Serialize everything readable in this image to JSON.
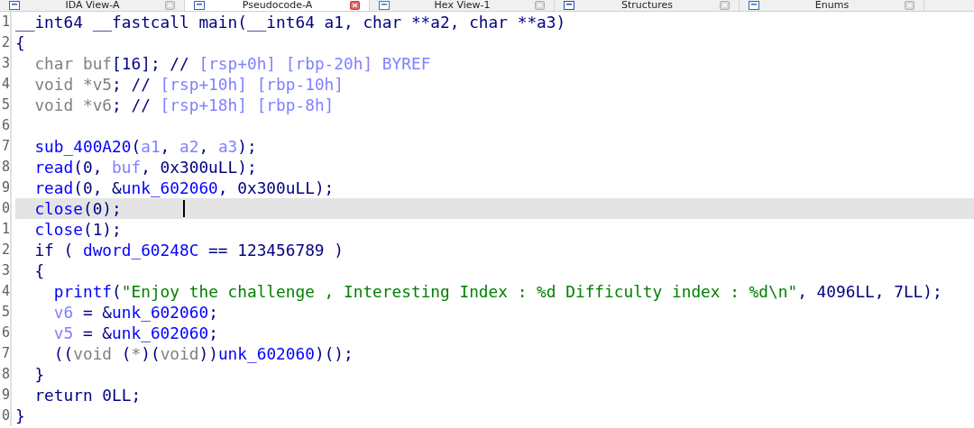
{
  "tabs": [
    {
      "label": "IDA View-A",
      "selected": false
    },
    {
      "label": "Pseudocode-A",
      "selected": true
    },
    {
      "label": "Hex View-1",
      "selected": false
    },
    {
      "label": "Structures",
      "selected": false
    },
    {
      "label": "Enums",
      "selected": false
    }
  ],
  "lines": [
    {
      "number": "1",
      "current": false,
      "tokens": [
        {
          "kind": "plain",
          "text": "__int64 __fastcall main(__int64 a1, char **a2, char **a3)"
        }
      ]
    },
    {
      "number": "2",
      "current": false,
      "tokens": [
        {
          "kind": "plain",
          "text": "{"
        }
      ]
    },
    {
      "number": "3",
      "current": false,
      "tokens": [
        {
          "kind": "type",
          "text": "  char buf"
        },
        {
          "kind": "plain",
          "text": "[16]; // "
        },
        {
          "kind": "comment",
          "text": "[rsp+0h] [rbp-20h] BYREF"
        }
      ]
    },
    {
      "number": "4",
      "current": false,
      "tokens": [
        {
          "kind": "type",
          "text": "  void *v5"
        },
        {
          "kind": "plain",
          "text": "; // "
        },
        {
          "kind": "comment",
          "text": "[rsp+10h] [rbp-10h]"
        }
      ]
    },
    {
      "number": "5",
      "current": false,
      "tokens": [
        {
          "kind": "type",
          "text": "  void *v6"
        },
        {
          "kind": "plain",
          "text": "; // "
        },
        {
          "kind": "comment",
          "text": "[rsp+18h] [rbp-8h]"
        }
      ]
    },
    {
      "number": "6",
      "current": false
    },
    {
      "number": "7",
      "current": false,
      "tokens": [
        {
          "kind": "name",
          "text": "  sub_400A20"
        },
        {
          "kind": "plain",
          "text": "("
        },
        {
          "kind": "local",
          "text": "a1"
        },
        {
          "kind": "plain",
          "text": ", "
        },
        {
          "kind": "local",
          "text": "a2"
        },
        {
          "kind": "plain",
          "text": ", "
        },
        {
          "kind": "local",
          "text": "a3"
        },
        {
          "kind": "plain",
          "text": ");"
        }
      ]
    },
    {
      "number": "8",
      "current": false,
      "tokens": [
        {
          "kind": "name",
          "text": "  read"
        },
        {
          "kind": "plain",
          "text": "(0, "
        },
        {
          "kind": "local",
          "text": "buf"
        },
        {
          "kind": "plain",
          "text": ", 0x300uLL);"
        }
      ]
    },
    {
      "number": "9",
      "current": false,
      "tokens": [
        {
          "kind": "name",
          "text": "  read"
        },
        {
          "kind": "plain",
          "text": "(0, &"
        },
        {
          "kind": "name",
          "text": "unk_602060"
        },
        {
          "kind": "plain",
          "text": ", 0x300uLL);"
        }
      ]
    },
    {
      "number": "0",
      "current": true,
      "tokens": [
        {
          "kind": "name",
          "text": "  close"
        },
        {
          "kind": "plain",
          "text": "(0);"
        }
      ]
    },
    {
      "number": "1",
      "current": false,
      "tokens": [
        {
          "kind": "name",
          "text": "  close"
        },
        {
          "kind": "plain",
          "text": "(1);"
        }
      ]
    },
    {
      "number": "2",
      "current": false,
      "tokens": [
        {
          "kind": "plain",
          "text": "  if ( "
        },
        {
          "kind": "name",
          "text": "dword_60248C"
        },
        {
          "kind": "plain",
          "text": " == 123456789 )"
        }
      ]
    },
    {
      "number": "3",
      "current": false,
      "tokens": [
        {
          "kind": "plain",
          "text": "  {"
        }
      ]
    },
    {
      "number": "4",
      "current": false,
      "tokens": [
        {
          "kind": "name",
          "text": "    printf"
        },
        {
          "kind": "plain",
          "text": "("
        },
        {
          "kind": "string",
          "text": "\"Enjoy the challenge , Interesting Index : %d Difficulty index : %d\\n\""
        },
        {
          "kind": "plain",
          "text": ", 4096LL, 7LL);"
        }
      ]
    },
    {
      "number": "5",
      "current": false,
      "tokens": [
        {
          "kind": "local",
          "text": "    v6"
        },
        {
          "kind": "plain",
          "text": " = &"
        },
        {
          "kind": "name",
          "text": "unk_602060"
        },
        {
          "kind": "plain",
          "text": ";"
        }
      ]
    },
    {
      "number": "6",
      "current": false,
      "tokens": [
        {
          "kind": "local",
          "text": "    v5"
        },
        {
          "kind": "plain",
          "text": " = &"
        },
        {
          "kind": "name",
          "text": "unk_602060"
        },
        {
          "kind": "plain",
          "text": ";"
        }
      ]
    },
    {
      "number": "7",
      "current": false,
      "tokens": [
        {
          "kind": "plain",
          "text": "    (("
        },
        {
          "kind": "type",
          "text": "void"
        },
        {
          "kind": "plain",
          "text": " ("
        },
        {
          "kind": "type",
          "text": "*"
        },
        {
          "kind": "plain",
          "text": ")("
        },
        {
          "kind": "type",
          "text": "void"
        },
        {
          "kind": "plain",
          "text": "))"
        },
        {
          "kind": "name",
          "text": "unk_602060"
        },
        {
          "kind": "plain",
          "text": ")();"
        }
      ]
    },
    {
      "number": "8",
      "current": false,
      "tokens": [
        {
          "kind": "plain",
          "text": "  }"
        }
      ]
    },
    {
      "number": "9",
      "current": false,
      "tokens": [
        {
          "kind": "plain",
          "text": "  return 0LL;"
        }
      ]
    },
    {
      "number": "0",
      "current": false,
      "tokens": [
        {
          "kind": "plain",
          "text": "}"
        }
      ]
    }
  ]
}
